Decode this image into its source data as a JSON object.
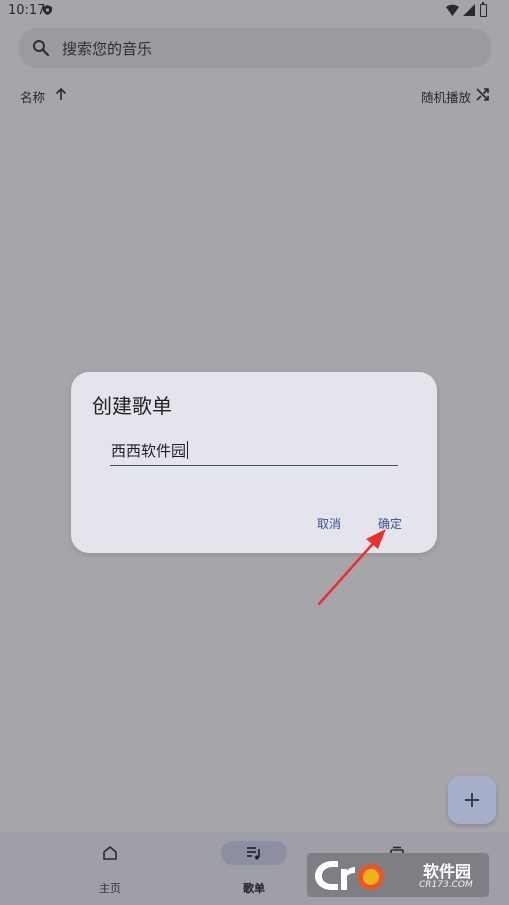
{
  "status_bar": {
    "time": "10:17"
  },
  "search": {
    "placeholder": "搜索您的音乐"
  },
  "sort": {
    "label": "名称",
    "shuffle_label": "随机播放"
  },
  "dialog": {
    "title": "创建歌单",
    "input_value": "西西软件园",
    "cancel_label": "取消",
    "ok_label": "确定"
  },
  "bottom_nav": {
    "items": [
      {
        "label": "主页",
        "icon": "home-icon",
        "active": false
      },
      {
        "label": "歌单",
        "icon": "playlist-icon",
        "active": true
      },
      {
        "label": "",
        "icon": "library-icon",
        "active": false
      }
    ]
  },
  "watermark": {
    "brand": "软件园",
    "domain": "CR173.COM"
  },
  "colors": {
    "background": "#a6a6aa",
    "dialog": "#e4e5ec",
    "accent": "#3b4f8f",
    "annotation": "#e8322d"
  }
}
